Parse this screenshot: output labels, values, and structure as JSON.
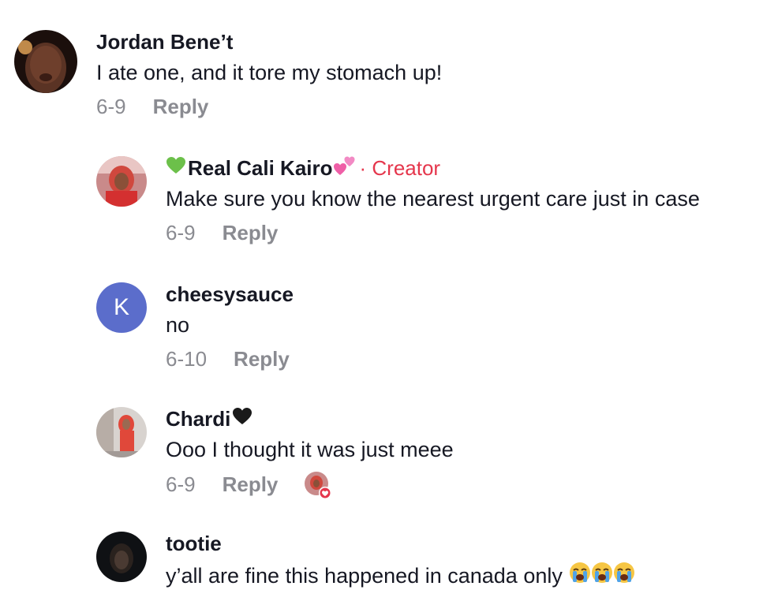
{
  "comments": [
    {
      "username": "Jordan Bene’t",
      "text": "I ate one, and it tore my stomach up!",
      "date": "6-9",
      "reply_label": "Reply"
    },
    {
      "username": "Real Cali Kairo",
      "username_prefix_icon": "green-heart-icon",
      "username_suffix_icon": "two-hearts-icon",
      "badge": "· Creator",
      "text": "Make sure you know the nearest urgent care just in case",
      "date": "6-9",
      "reply_label": "Reply"
    },
    {
      "username": "cheesysauce",
      "avatar_letter": "K",
      "text": "no",
      "date": "6-10",
      "reply_label": "Reply"
    },
    {
      "username": "Chardi",
      "username_suffix_icon": "black-heart-icon",
      "text": "Ooo I thought it was just meee",
      "date": "6-9",
      "reply_label": "Reply",
      "liked_by_creator": true
    },
    {
      "username": "tootie",
      "text": "y’all are fine this happened in canada only",
      "text_suffix_icons": [
        "loudly-crying-face-icon",
        "loudly-crying-face-icon",
        "loudly-crying-face-icon"
      ],
      "date": "",
      "reply_label": ""
    }
  ],
  "colors": {
    "creator_badge": "#e5364c",
    "meta_text": "#8a8b91",
    "letter_avatar_bg": "#5b6dcb",
    "like_heart": "#e5364c"
  }
}
